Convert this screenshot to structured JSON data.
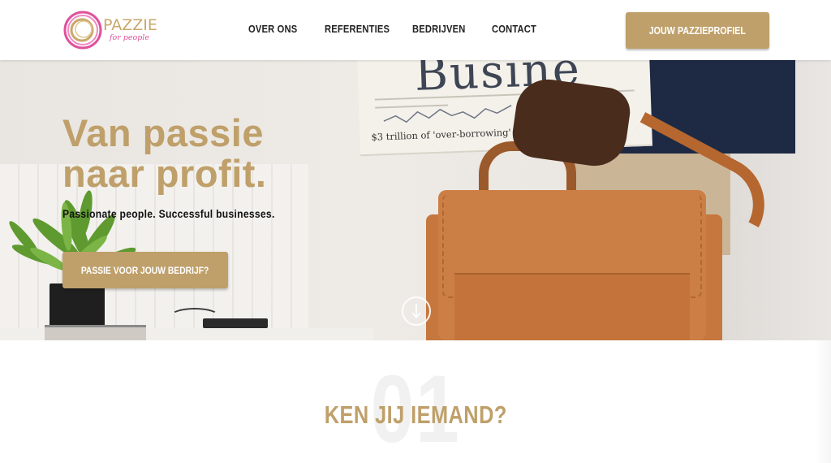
{
  "header": {
    "logo_text": "PAZZIE",
    "logo_subtext": "for people",
    "nav": [
      {
        "label": "OVER ONS"
      },
      {
        "label": "REFERENTIES"
      },
      {
        "label": "BEDRIJVEN"
      },
      {
        "label": "CONTACT"
      }
    ],
    "cta_label": "JOUW PAZZIEPROFIEL"
  },
  "hero": {
    "title_line1": "Van passie",
    "title_line2": "naar profit.",
    "subtitle": "Passionate people. Successful businesses.",
    "button_label": "PASSIE VOOR JOUW BEDRIJF?",
    "newspaper_masthead": "Busine",
    "newspaper_headline": "$3 trillion of 'over-borrowing' risks new glo"
  },
  "section": {
    "number": "01",
    "title": "KEN JIJ IEMAND?"
  },
  "colors": {
    "gold": "#bfa06a",
    "logo_pink": "#e0519b",
    "text_dark": "#222222"
  },
  "icons": {
    "logo": "ring-logo-icon",
    "scroll": "arrow-down-circle-icon"
  }
}
